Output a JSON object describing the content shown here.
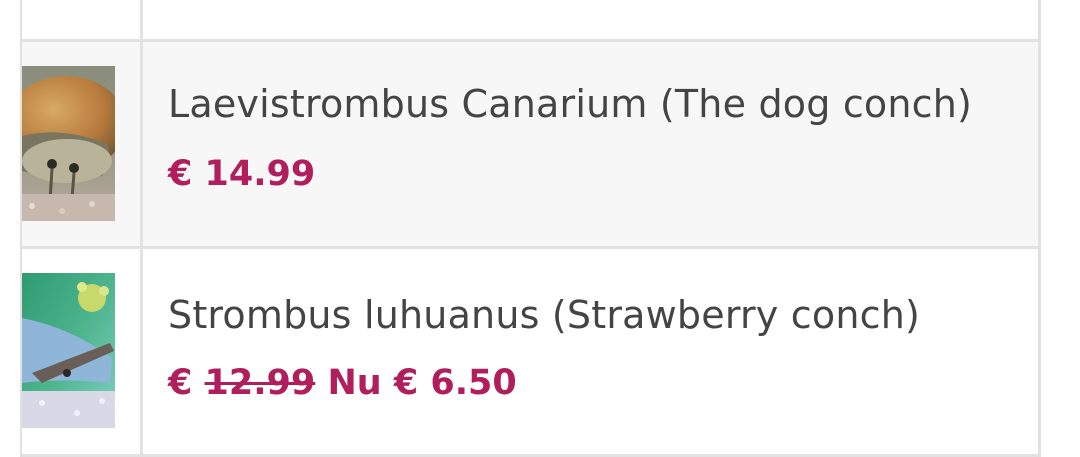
{
  "products": [
    {
      "name": "Laevistrombus Canarium (The dog conch)",
      "currency": "€",
      "price": "14.99"
    },
    {
      "name": "Strombus luhuanus (Strawberry conch)",
      "currency": "€",
      "old_price": "12.99",
      "sale_label": "Nu",
      "sale_currency": "€",
      "sale_price": "6.50"
    }
  ]
}
